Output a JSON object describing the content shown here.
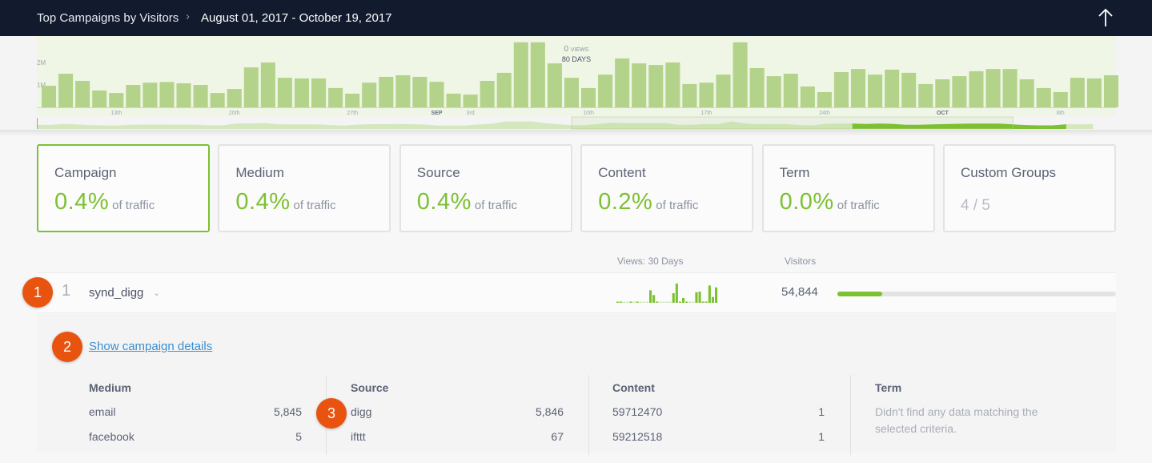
{
  "header": {
    "title": "Top Campaigns by Visitors",
    "separator": ">",
    "date_range": "August 01, 2017 - October 19, 2017",
    "scroll_top_icon": "arrow-up-icon"
  },
  "chart_data": {
    "type": "bar",
    "title": "",
    "xlabel": "",
    "ylabel": "Views",
    "y_ticks": [
      "1M",
      "2M"
    ],
    "ylim": [
      0,
      2.8
    ],
    "y_unit": "M",
    "hover_label": {
      "value": "0",
      "unit": "VIEWS",
      "span": "80 DAYS"
    },
    "x_tick_labels": [
      {
        "label": "13th",
        "index": 4,
        "bold": false
      },
      {
        "label": "20th",
        "index": 11,
        "bold": false
      },
      {
        "label": "27th",
        "index": 18,
        "bold": false
      },
      {
        "label": "SEP",
        "index": 23,
        "bold": true
      },
      {
        "label": "3rd",
        "index": 25,
        "bold": false
      },
      {
        "label": "10th",
        "index": 32,
        "bold": false
      },
      {
        "label": "17th",
        "index": 39,
        "bold": false
      },
      {
        "label": "24th",
        "index": 46,
        "bold": false
      },
      {
        "label": "OCT",
        "index": 53,
        "bold": true
      },
      {
        "label": "8th",
        "index": 60,
        "bold": false
      }
    ],
    "values": [
      0.96,
      1.5,
      1.18,
      0.75,
      0.64,
      1.0,
      1.1,
      1.13,
      1.07,
      1.0,
      0.64,
      0.82,
      1.78,
      2.0,
      1.32,
      1.29,
      1.29,
      0.86,
      0.61,
      1.1,
      1.36,
      1.43,
      1.36,
      1.14,
      0.61,
      0.57,
      1.18,
      1.54,
      2.9,
      2.9,
      1.96,
      1.32,
      0.86,
      1.46,
      2.18,
      1.96,
      1.89,
      2.0,
      1.04,
      1.1,
      1.46,
      2.9,
      1.75,
      1.39,
      1.5,
      0.93,
      0.68,
      1.57,
      1.71,
      1.46,
      1.68,
      1.54,
      1.04,
      1.25,
      1.39,
      1.61,
      1.71,
      1.71,
      1.25,
      0.86,
      0.68,
      1.32,
      1.29,
      1.43
    ],
    "overview_selection": {
      "start_index": 40,
      "end_index": 79,
      "total_days": 80
    }
  },
  "cards": [
    {
      "label": "Campaign",
      "value": "0.4%",
      "suffix": "of traffic",
      "active": true
    },
    {
      "label": "Medium",
      "value": "0.4%",
      "suffix": "of traffic",
      "active": false
    },
    {
      "label": "Source",
      "value": "0.4%",
      "suffix": "of traffic",
      "active": false
    },
    {
      "label": "Content",
      "value": "0.2%",
      "suffix": "of traffic",
      "active": false
    },
    {
      "label": "Term",
      "value": "0.0%",
      "suffix": "of traffic",
      "active": false
    },
    {
      "label": "Custom Groups",
      "value": "4 / 5",
      "suffix": "",
      "active": false
    }
  ],
  "list": {
    "col_views": "Views: 30 Days",
    "col_visitors": "Visitors",
    "rows": [
      {
        "rank": "1",
        "name": "synd_digg",
        "visitors": "54,844",
        "visitor_share": 0.16,
        "spark": [
          0.05,
          0.05,
          0.02,
          0.02,
          0.05,
          0.02,
          0.05,
          0.02,
          0.02,
          0.02,
          0.65,
          0.4,
          0.05,
          0.02,
          0.02,
          0.02,
          0.02,
          0.5,
          1.0,
          0.05,
          0.25,
          0.05,
          0.02,
          0.02,
          0.55,
          0.58,
          0.05,
          0.05,
          0.9,
          0.3,
          0.8
        ],
        "expanded": true
      }
    ]
  },
  "details": {
    "show_link": "Show campaign details",
    "columns": [
      {
        "header": "Medium",
        "items": [
          {
            "key": "email",
            "value": "5,845"
          },
          {
            "key": "facebook",
            "value": "5"
          }
        ]
      },
      {
        "header": "Source",
        "items": [
          {
            "key": "digg",
            "value": "5,846"
          },
          {
            "key": "ifttt",
            "value": "67"
          }
        ]
      },
      {
        "header": "Content",
        "items": [
          {
            "key": "59712470",
            "value": "1"
          },
          {
            "key": "59212518",
            "value": "1"
          }
        ]
      },
      {
        "header": "Term",
        "items": [],
        "empty_message": "Didn't find any data matching the selected criteria."
      }
    ]
  },
  "annotations": [
    "1",
    "2",
    "3"
  ],
  "colors": {
    "accent_green": "#7cc132",
    "bar_green": "#b3d38a",
    "chart_bg": "#eff6e6",
    "header_bg": "#121a2e",
    "badge_orange": "#e8540f",
    "link_blue": "#3b8fd1"
  }
}
